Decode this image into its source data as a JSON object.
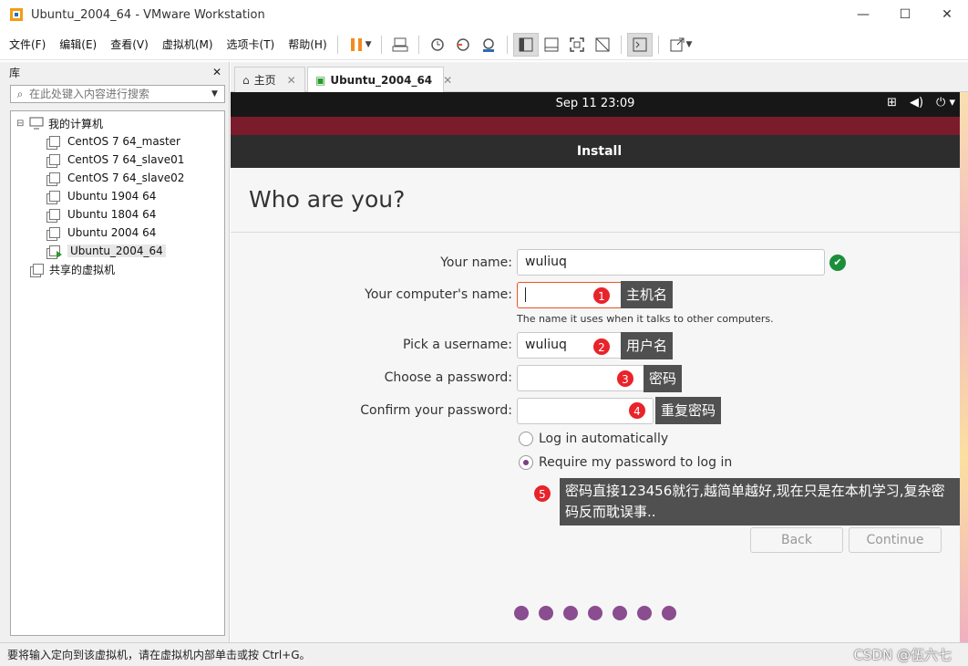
{
  "window": {
    "title": "Ubuntu_2004_64 - VMware Workstation",
    "minimize": "—",
    "maximize": "☐",
    "close": "✕"
  },
  "menu": [
    "文件(F)",
    "编辑(E)",
    "查看(V)",
    "虚拟机(M)",
    "选项卡(T)",
    "帮助(H)"
  ],
  "library": {
    "title": "库",
    "close": "✕",
    "search_placeholder": "在此处键入内容进行搜索",
    "root": "我的计算机",
    "vms": [
      "CentOS 7 64_master",
      "CentOS 7 64_slave01",
      "CentOS 7 64_slave02",
      "Ubuntu 1904 64",
      "Ubuntu 1804 64",
      "Ubuntu 2004 64",
      "Ubuntu_2004_64"
    ],
    "selected_vm": "Ubuntu_2004_64",
    "shared": "共享的虚拟机"
  },
  "tabs": [
    {
      "label": "主页",
      "close": "✕"
    },
    {
      "label": "Ubuntu_2004_64",
      "close": "✕",
      "active": true
    }
  ],
  "guest": {
    "clock": "Sep 11  23:09",
    "installer_title": "Install",
    "heading": "Who are you?",
    "form": {
      "your_name_label": "Your name:",
      "your_name_value": "wuliuq",
      "computer_name_label": "Your computer's name:",
      "computer_name_value": "",
      "computer_name_hint": "The name it uses when it talks to other computers.",
      "username_label": "Pick a username:",
      "username_value": "wuliuq",
      "password_label": "Choose a password:",
      "confirm_label": "Confirm your password:",
      "login_auto": "Log in automatically",
      "login_require": "Require my password to log in",
      "selected_option": "login_require"
    },
    "back": "Back",
    "continue": "Continue",
    "progress_steps": 7
  },
  "annotations": [
    {
      "n": "1",
      "text": "主机名"
    },
    {
      "n": "2",
      "text": "用户名"
    },
    {
      "n": "3",
      "text": "密码"
    },
    {
      "n": "4",
      "text": "重复密码"
    },
    {
      "n": "5",
      "text": "密码直接123456就行,越简单越好,现在只是在本机学习,复杂密码反而耽误事.."
    }
  ],
  "status": {
    "text": "要将输入定向到该虚拟机，请在虚拟机内部单击或按 Ctrl+G。",
    "watermark": "CSDN @伍六七"
  },
  "colors": {
    "accent": "#e95420",
    "ok_green": "#1b8e3a",
    "badge_red": "#e8232a",
    "progress_purple": "#8a4d8f"
  }
}
